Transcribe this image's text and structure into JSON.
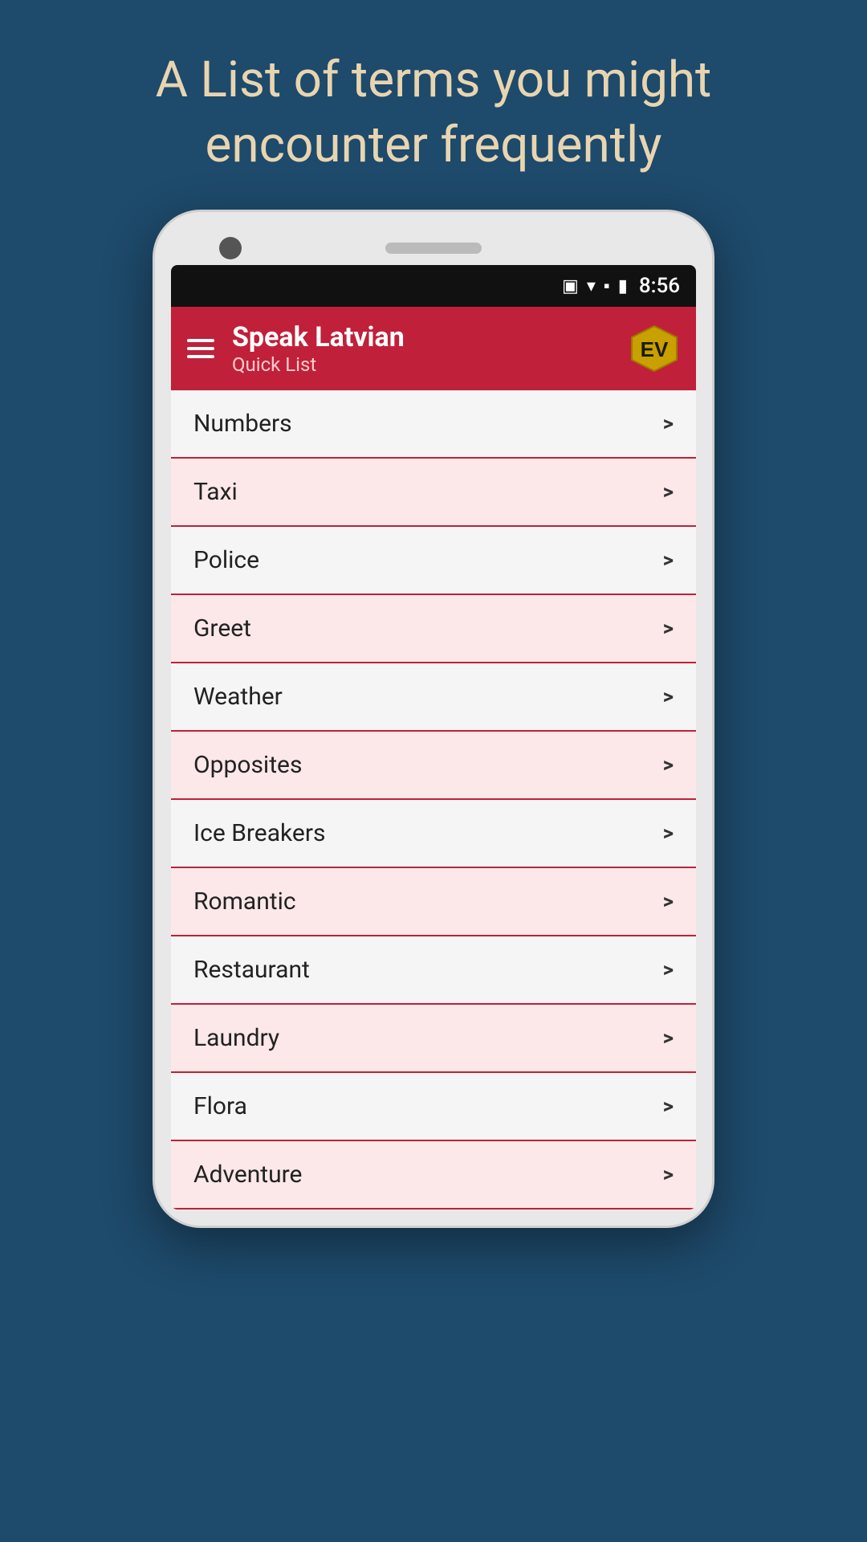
{
  "background": {
    "color": "#1e4a6b"
  },
  "header": {
    "text": "A List of terms you might encounter frequently"
  },
  "status_bar": {
    "time": "8:56",
    "icons": [
      "vibrate",
      "wifi",
      "signal",
      "battery"
    ]
  },
  "app_bar": {
    "title": "Speak Latvian",
    "subtitle": "Quick List",
    "menu_label": "menu",
    "logo_label": "EV"
  },
  "list_items": [
    {
      "label": "Numbers",
      "arrow": ">"
    },
    {
      "label": "Taxi",
      "arrow": ">"
    },
    {
      "label": "Police",
      "arrow": ">"
    },
    {
      "label": "Greet",
      "arrow": ">"
    },
    {
      "label": "Weather",
      "arrow": ">"
    },
    {
      "label": "Opposites",
      "arrow": ">"
    },
    {
      "label": "Ice Breakers",
      "arrow": ">"
    },
    {
      "label": "Romantic",
      "arrow": ">"
    },
    {
      "label": "Restaurant",
      "arrow": ">"
    },
    {
      "label": "Laundry",
      "arrow": ">"
    },
    {
      "label": "Flora",
      "arrow": ">"
    },
    {
      "label": "Adventure",
      "arrow": ">"
    }
  ]
}
